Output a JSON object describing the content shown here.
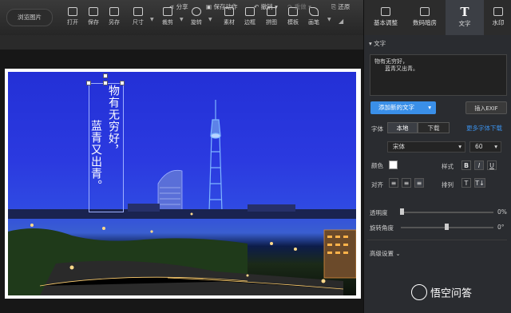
{
  "toolbar": {
    "browse_label": "浏览图片",
    "tools": [
      {
        "label": "打开",
        "icon": "folder-open-icon"
      },
      {
        "label": "保存",
        "icon": "save-icon"
      },
      {
        "label": "另存",
        "icon": "save-as-icon"
      },
      {
        "label": "尺寸",
        "icon": "resize-icon"
      },
      {
        "label": "裁剪",
        "icon": "crop-icon"
      },
      {
        "label": "旋转",
        "icon": "rotate-icon"
      },
      {
        "label": "素材",
        "icon": "sticker-icon"
      },
      {
        "label": "边框",
        "icon": "border-icon"
      },
      {
        "label": "拼图",
        "icon": "collage-icon"
      },
      {
        "label": "模板",
        "icon": "template-icon"
      },
      {
        "label": "画笔",
        "icon": "brush-icon"
      }
    ]
  },
  "side_tabs": [
    {
      "label": "基本调整",
      "icon": "adjust-icon"
    },
    {
      "label": "数码暗房",
      "icon": "darkroom-icon"
    },
    {
      "label": "文字",
      "icon": "text-icon"
    },
    {
      "label": "水印",
      "icon": "watermark-icon"
    }
  ],
  "subbar": {
    "share": "分享",
    "save_action": "保存动作",
    "undo": "撤销",
    "redo": "重做",
    "restore": "还原"
  },
  "canvas": {
    "text_col1": "物有无穷好，",
    "text_col2": "蓝青又出青。"
  },
  "panel": {
    "section_title": "文字",
    "textarea_line1": "物有无穷好，",
    "textarea_line2": "蓝青又出青。",
    "add_text_button": "添加新的文字",
    "insert_exif": "插入EXIF",
    "font_label": "字体",
    "font_local": "本地",
    "font_download": "下载",
    "more_fonts": "更多字体下载",
    "font_value": "宋体",
    "size_value": "60",
    "color_label": "颜色",
    "style_label": "样式",
    "style_b": "B",
    "style_i": "I",
    "style_u": "U",
    "align_label": "对齐",
    "arrange_label": "排列",
    "arrange_h": "T",
    "arrange_v": "T↓",
    "opacity_label": "透明度",
    "opacity_value": "0%",
    "angle_label": "旋转角度",
    "angle_value": "0°",
    "advanced": "高级设置",
    "colors": {
      "accent": "#3a8fe8",
      "text_color": "#ffffff"
    }
  },
  "watermark": "悟空问答"
}
